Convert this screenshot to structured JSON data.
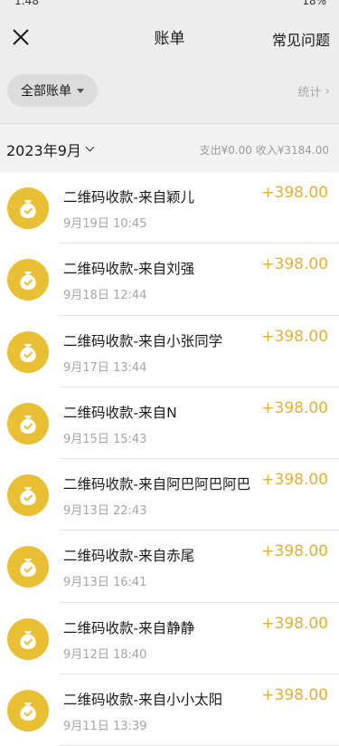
{
  "status_bar": {
    "time": "1:48",
    "battery": "18%"
  },
  "nav": {
    "title": "账单",
    "faq_label": "常见问题",
    "close_icon": "close-icon"
  },
  "filter": {
    "chip_label": "全部账单",
    "stats_label": "统计"
  },
  "month": {
    "label": "2023年9月",
    "summary": "支出¥0.00 收入¥3184.00"
  },
  "colors": {
    "accent": "#e3b12f",
    "icon_bg": "#e9bf34"
  },
  "items": [
    {
      "title": "二维码收款-来自颖儿",
      "date": "9月19日 10:45",
      "amount": "+398.00",
      "icon": "money-bag-icon"
    },
    {
      "title": "二维码收款-来自刘强",
      "date": "9月18日 12:44",
      "amount": "+398.00",
      "icon": "money-bag-icon"
    },
    {
      "title": "二维码收款-来自小张同学",
      "date": "9月17日 13:44",
      "amount": "+398.00",
      "icon": "money-bag-icon"
    },
    {
      "title": "二维码收款-来自N",
      "date": "9月15日 15:43",
      "amount": "+398.00",
      "icon": "money-bag-icon"
    },
    {
      "title": "二维码收款-来自阿巴阿巴阿巴",
      "date": "9月13日 22:43",
      "amount": "+398.00",
      "icon": "money-bag-icon"
    },
    {
      "title": "二维码收款-来自赤尾",
      "date": "9月13日 16:41",
      "amount": "+398.00",
      "icon": "money-bag-icon"
    },
    {
      "title": "二维码收款-来自静静",
      "date": "9月12日 18:40",
      "amount": "+398.00",
      "icon": "money-bag-icon"
    },
    {
      "title": "二维码收款-来自小小太阳",
      "date": "9月11日 13:39",
      "amount": "+398.00",
      "icon": "money-bag-icon"
    }
  ]
}
